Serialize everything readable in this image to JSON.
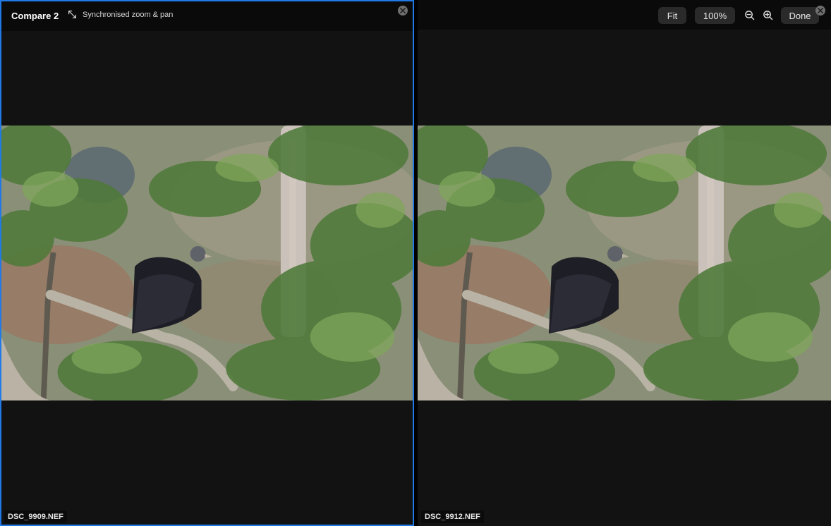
{
  "compare": {
    "title": "Compare 2",
    "sync_label": "Synchronised zoom & pan"
  },
  "toolbar": {
    "fit_label": "Fit",
    "zoom_level": "100%",
    "done_label": "Done"
  },
  "panes": [
    {
      "filename": "DSC_9909.NEF",
      "selected": true
    },
    {
      "filename": "DSC_9912.NEF",
      "selected": false
    }
  ],
  "colors": {
    "accent": "#1f7ae8",
    "background": "#121212",
    "toolbar_button": "#2a2a2a"
  },
  "icons": [
    "sync-zoom-icon",
    "close-icon",
    "zoom-out-icon",
    "zoom-in-icon"
  ]
}
